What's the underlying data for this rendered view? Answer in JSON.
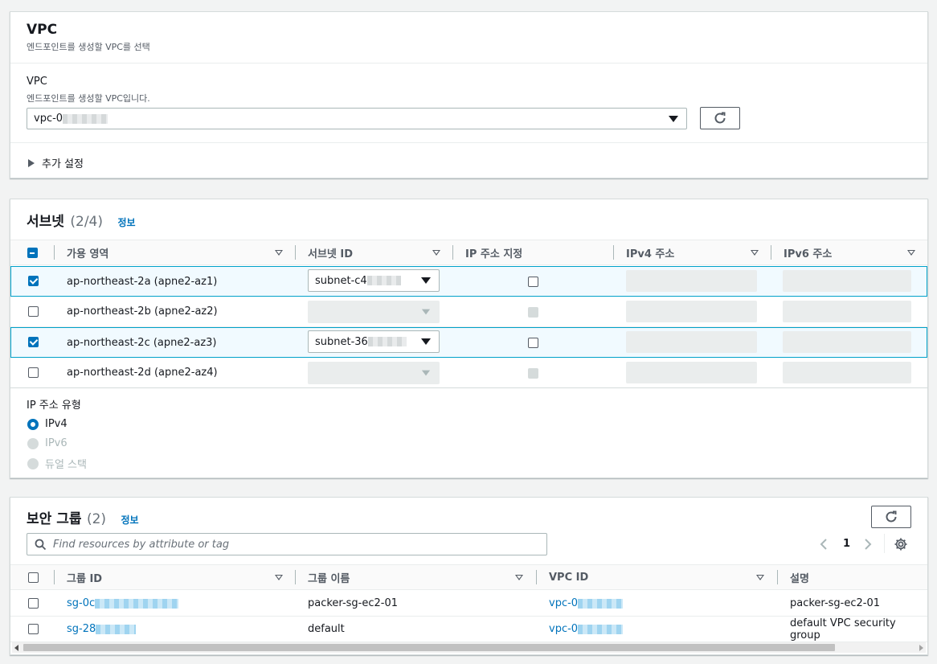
{
  "vpc_panel": {
    "title": "VPC",
    "description": "엔드포인트를 생성할 VPC를 선택",
    "field_label": "VPC",
    "field_description": "엔드포인트를 생성할 VPC입니다.",
    "selected_vpc": "vpc-0",
    "refresh_icon": "refresh-icon",
    "additional_settings": "추가 설정"
  },
  "subnet_panel": {
    "title": "서브넷",
    "count": "(2/4)",
    "info": "정보",
    "columns": [
      "가용 영역",
      "서브넷 ID",
      "IP 주소 지정",
      "IPv4 주소",
      "IPv6 주소"
    ],
    "rows": [
      {
        "az": "ap-northeast-2a (apne2-az1)",
        "subnet": "subnet-c4",
        "checked": true
      },
      {
        "az": "ap-northeast-2b (apne2-az2)",
        "subnet": "",
        "checked": false
      },
      {
        "az": "ap-northeast-2c (apne2-az3)",
        "subnet": "subnet-36",
        "checked": true
      },
      {
        "az": "ap-northeast-2d (apne2-az4)",
        "subnet": "",
        "checked": false
      }
    ],
    "ip_type_label": "IP 주소 유형",
    "ip_types": [
      {
        "label": "IPv4",
        "selected": true,
        "enabled": true
      },
      {
        "label": "IPv6",
        "selected": false,
        "enabled": false
      },
      {
        "label": "듀얼 스택",
        "selected": false,
        "enabled": false
      }
    ]
  },
  "sg_panel": {
    "title": "보안 그룹",
    "count": "(2)",
    "info": "정보",
    "search_placeholder": "Find resources by attribute or tag",
    "page": "1",
    "columns": [
      "그룹 ID",
      "그룹 이름",
      "VPC ID",
      "설명"
    ],
    "rows": [
      {
        "group_id": "sg-0c",
        "name": "packer-sg-ec2-01",
        "vpc": "vpc-0",
        "desc": "packer-sg-ec2-01"
      },
      {
        "group_id": "sg-28",
        "name": "default",
        "vpc": "vpc-0",
        "desc": "default VPC security group"
      }
    ]
  },
  "colors": {
    "link": "#0073bb",
    "checkbox": "#0073bb",
    "selected_row_bg": "#f1faff",
    "selected_row_border": "#00a1c9"
  }
}
